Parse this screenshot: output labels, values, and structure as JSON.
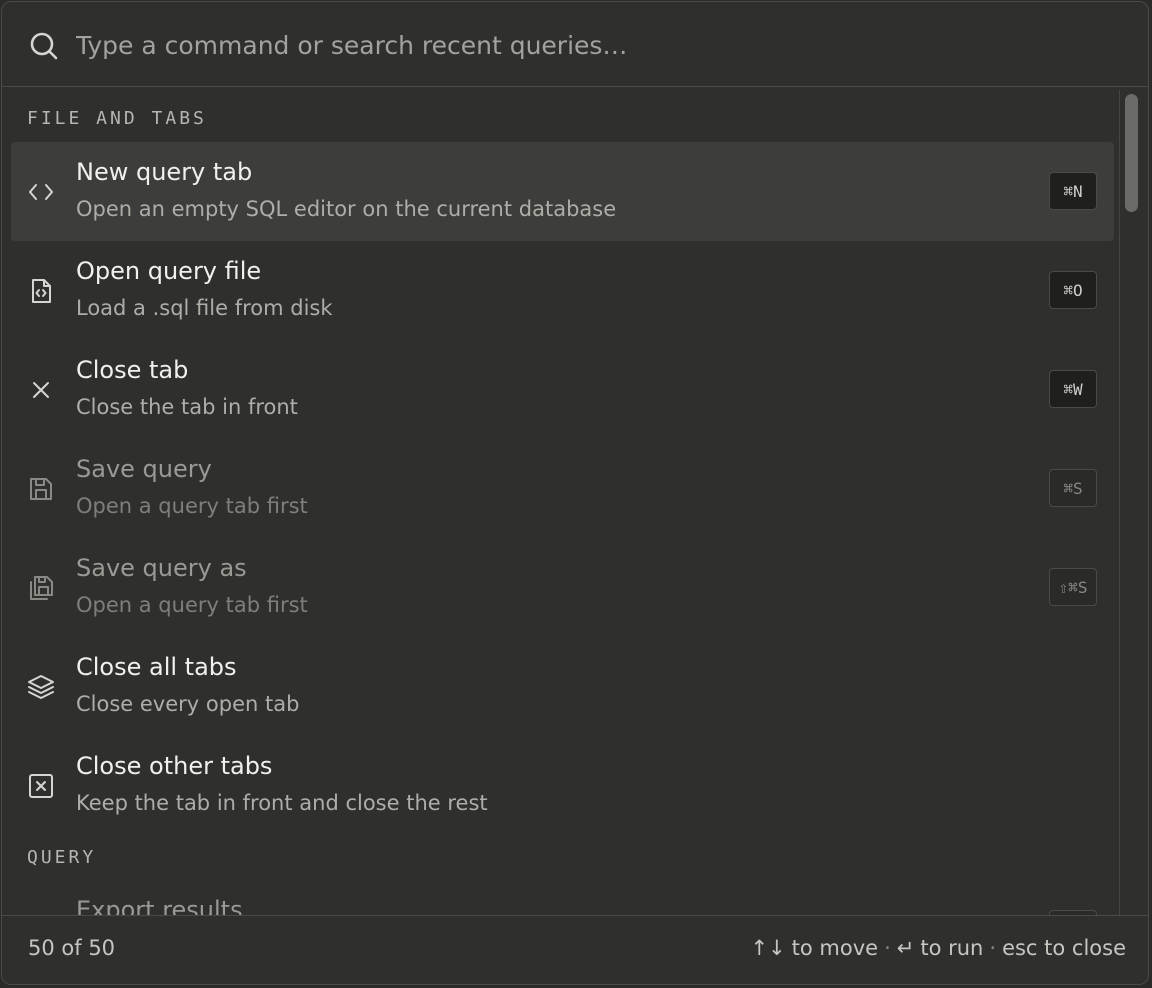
{
  "search": {
    "placeholder": "Type a command or search recent queries…",
    "icon": "search-icon"
  },
  "sections": [
    {
      "header": "FILE AND TABS",
      "items": [
        {
          "title": "New query tab",
          "desc": "Open an empty SQL editor on the current database",
          "shortcut": "⌘N",
          "icon": "code-icon",
          "selected": true,
          "disabled": false
        },
        {
          "title": "Open query file",
          "desc": "Load a .sql file from disk",
          "shortcut": "⌘O",
          "icon": "file-code-icon",
          "selected": false,
          "disabled": false
        },
        {
          "title": "Close tab",
          "desc": "Close the tab in front",
          "shortcut": "⌘W",
          "icon": "close-icon",
          "selected": false,
          "disabled": false
        },
        {
          "title": "Save query",
          "desc": "Open a query tab first",
          "shortcut": "⌘S",
          "icon": "save-icon",
          "selected": false,
          "disabled": true
        },
        {
          "title": "Save query as",
          "desc": "Open a query tab first",
          "shortcut": "⇧⌘S",
          "icon": "save-as-icon",
          "selected": false,
          "disabled": true
        },
        {
          "title": "Close all tabs",
          "desc": "Close every open tab",
          "shortcut": "",
          "icon": "layers-icon",
          "selected": false,
          "disabled": false
        },
        {
          "title": "Close other tabs",
          "desc": "Keep the tab in front and close the rest",
          "shortcut": "",
          "icon": "close-square-icon",
          "selected": false,
          "disabled": false
        }
      ]
    },
    {
      "header": "QUERY",
      "items": [
        {
          "title": "Export results",
          "desc": "",
          "shortcut": "",
          "icon": "export-icon",
          "selected": false,
          "disabled": true
        }
      ]
    }
  ],
  "footer": {
    "count": "50 of 50",
    "move_keys": "↑↓",
    "move_label": "to move",
    "run_key": "↵",
    "run_label": "to run",
    "close_label": "esc to close",
    "separator": "·"
  },
  "colors": {
    "background": "#2f302e",
    "selected_row": "#3d3e3b",
    "border": "#4a4b48"
  }
}
